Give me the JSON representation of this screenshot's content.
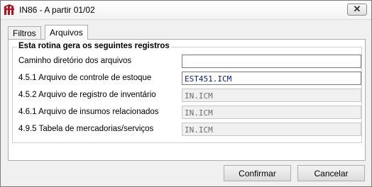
{
  "window": {
    "title": "IN86 - A partir 01/02",
    "close_glyph": "✕",
    "app_icon": "factory-logo-icon",
    "close_icon": "close-icon"
  },
  "tabs": [
    {
      "label": "Filtros",
      "active": false
    },
    {
      "label": "Arquivos",
      "active": true
    }
  ],
  "group": {
    "title": "Esta rotina gera os seguintes registros",
    "rows": [
      {
        "label": "Caminho diretório dos arquivos",
        "value": "",
        "enabled": true
      },
      {
        "label": "4.5.1 Arquivo de controle de estoque",
        "value": "EST451.ICM",
        "enabled": true
      },
      {
        "label": "4.5.2 Arquivo de registro de inventário",
        "value": "IN.ICM",
        "enabled": false
      },
      {
        "label": "4.6.1 Arquivo de insumos relacionados",
        "value": "IN.ICM",
        "enabled": false
      },
      {
        "label": "4.9.5 Tabela de mercadorias/serviços",
        "value": "IN.ICM",
        "enabled": false
      }
    ]
  },
  "buttons": {
    "confirm_label": "Confirmar",
    "cancel_label": "Cancelar"
  },
  "colors": {
    "logo": "#b5121b",
    "enabled_text": "#0a1a8a",
    "disabled_text": "#6d6d6d"
  }
}
